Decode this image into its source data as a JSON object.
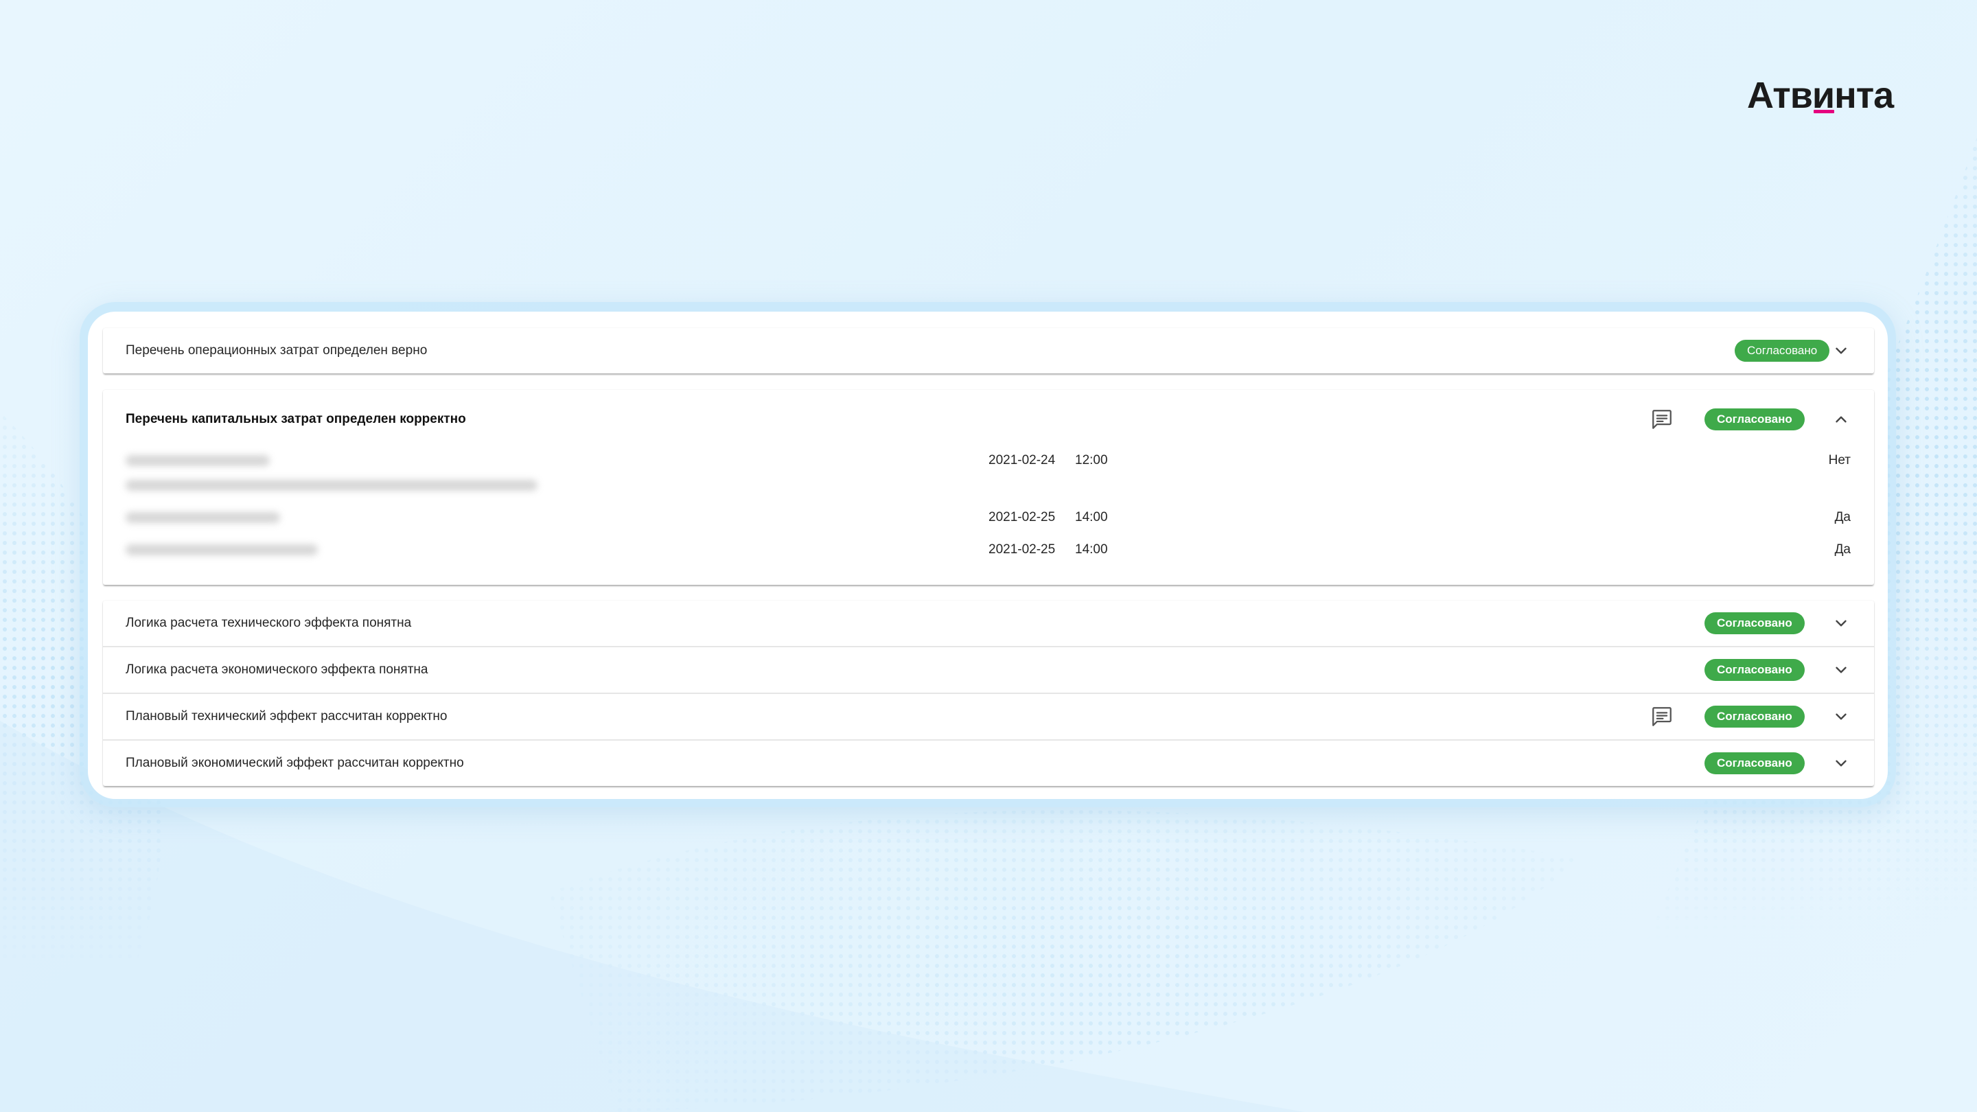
{
  "brand": {
    "logo_text": "Атвинта",
    "accent_color": "#e5007e"
  },
  "colors": {
    "status_green": "#3faa4a",
    "background": "#e4f4fd"
  },
  "criteria": [
    {
      "title": "Перечень операционных затрат определен верно",
      "status": "Согласовано",
      "expanded": false,
      "has_comment": false
    },
    {
      "title": "Перечень капитальных затрат определен корректно",
      "status": "Согласовано",
      "expanded": true,
      "has_comment": true,
      "details": [
        {
          "date": "2021-02-24",
          "time": "12:00",
          "answer": "Нет"
        },
        {
          "date": "2021-02-25",
          "time": "14:00",
          "answer": "Да"
        },
        {
          "date": "2021-02-25",
          "time": "14:00",
          "answer": "Да"
        }
      ]
    },
    {
      "title": "Логика расчета технического эффекта понятна",
      "status": "Согласовано",
      "expanded": false,
      "has_comment": false
    },
    {
      "title": "Логика расчета экономического эффекта понятна",
      "status": "Согласовано",
      "expanded": false,
      "has_comment": false
    },
    {
      "title": "Плановый технический эффект рассчитан корректно",
      "status": "Согласовано",
      "expanded": false,
      "has_comment": true
    },
    {
      "title": "Плановый экономический эффект рассчитан корректно",
      "status": "Согласовано",
      "expanded": false,
      "has_comment": false
    }
  ],
  "icons": {
    "expand": "chevron-down-icon",
    "collapse": "chevron-up-icon",
    "comment": "comment-icon"
  }
}
